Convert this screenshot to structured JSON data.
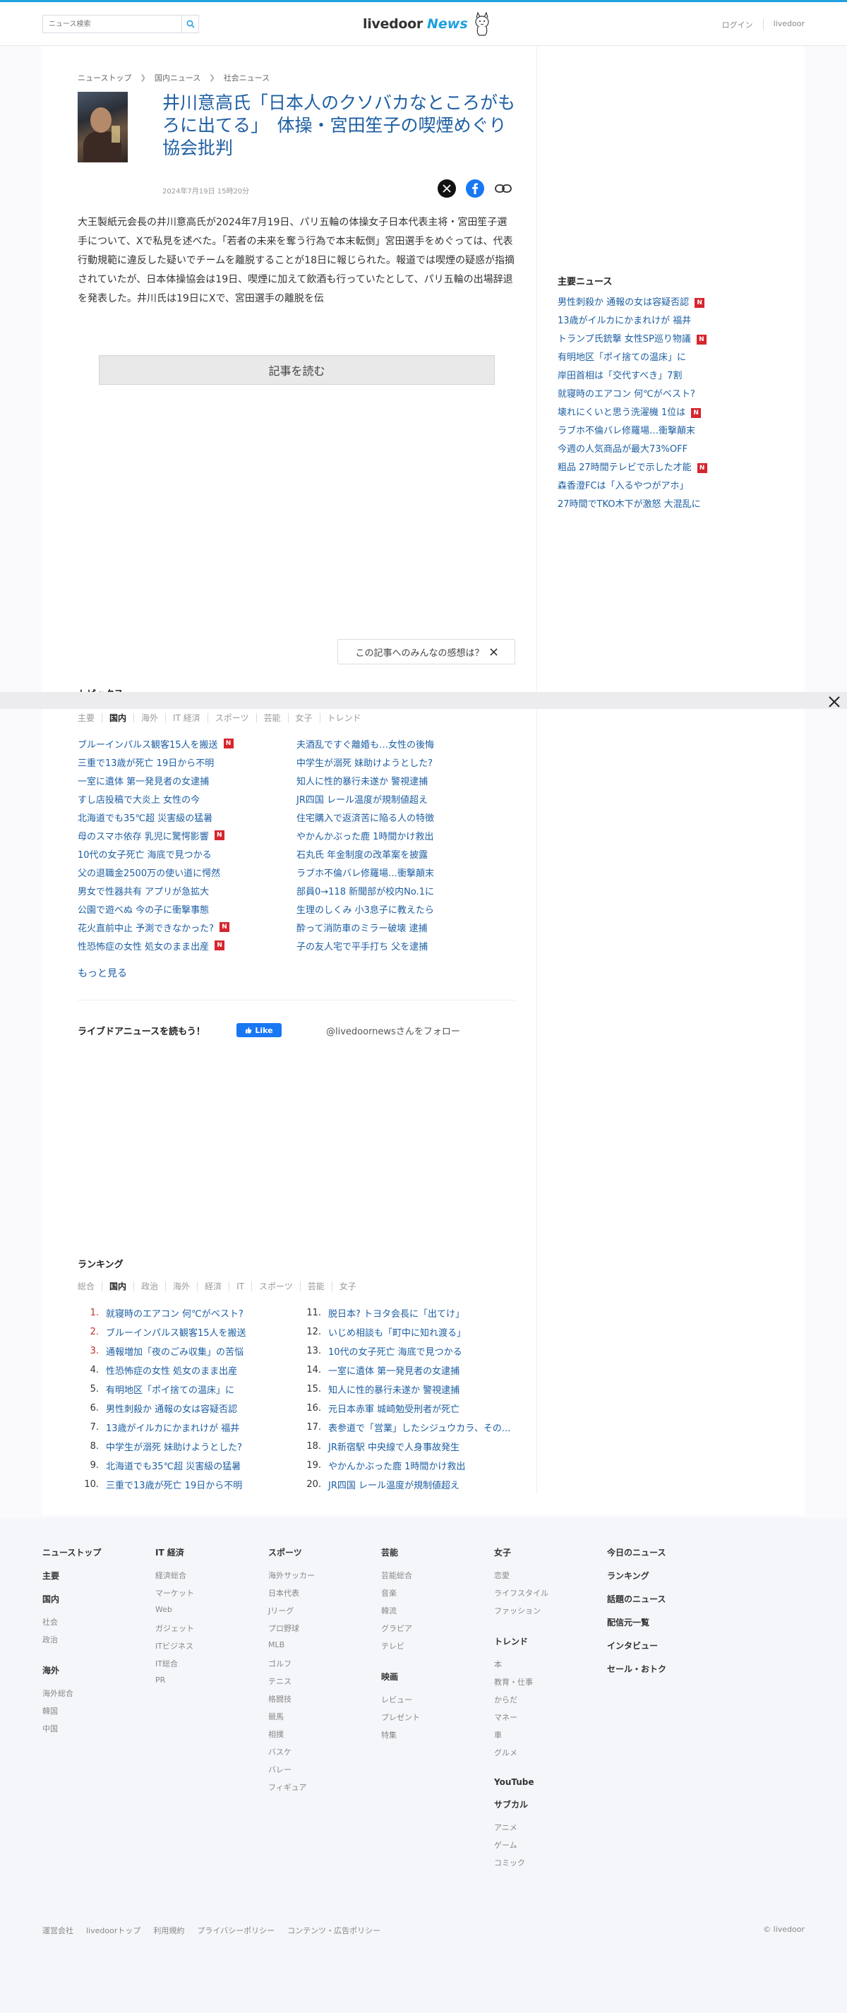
{
  "header": {
    "search_placeholder": "ニュース検索",
    "logo_word1": "livedoor",
    "logo_word2": "News",
    "links": [
      "ログイン",
      "livedoor"
    ]
  },
  "breadcrumb": [
    "ニューストップ",
    "国内ニュース",
    "社会ニュース"
  ],
  "article": {
    "title": "井川意高氏「日本人のクソバカなところがもろに出てる」　体操・宮田笙子の喫煙めぐり協会批判",
    "date": "2024年7月19日 15時20分",
    "body": "大王製紙元会長の井川意高氏が2024年7月19日、パリ五輪の体操女子日本代表主将・宮田笙子選手について、Xで私見を述べた。「若者の未来を奪う行為で本末転倒」宮田選手をめぐっては、代表行動規範に違反した疑いでチームを離脱することが18日に報じられた。報道では喫煙の疑惑が指摘されていたが、日本体操協会は19日、喫煙に加えて飲酒も行っていたとして、パリ五輪の出場辞退を発表した。井川氏は19日にXで、宮田選手の離脱を伝",
    "read_button": "記事を読む",
    "feel_button": "この記事へのみんなの感想は？"
  },
  "sidebar": {
    "title": "主要ニュース",
    "items": [
      {
        "text": "男性刺殺か 通報の女は容疑否認",
        "new": true
      },
      {
        "text": "13歳がイルカにかまれけが 福井",
        "new": false
      },
      {
        "text": "トランプ氏銃撃 女性SP巡り物議",
        "new": true
      },
      {
        "text": "有明地区「ポイ捨ての温床」に",
        "new": false
      },
      {
        "text": "岸田首相は「交代すべき」7割",
        "new": false
      },
      {
        "text": "就寝時のエアコン 何℃がベスト?",
        "new": false
      },
      {
        "text": "壊れにくいと思う洗濯機 1位は",
        "new": true
      },
      {
        "text": "ラブホ不倫バレ修羅場…衝撃顛末",
        "new": false
      },
      {
        "text": "今週の人気商品が最大73%OFF",
        "new": false
      },
      {
        "text": "粗品 27時間テレビで示した才能",
        "new": true
      },
      {
        "text": "森香澄FCは「入るやつがアホ」",
        "new": false
      },
      {
        "text": "27時間でTKO木下が激怒 大混乱に",
        "new": false
      }
    ]
  },
  "topics": {
    "title": "トピックス",
    "tabs": [
      "主要",
      "国内",
      "海外",
      "IT 経済",
      "スポーツ",
      "芸能",
      "女子",
      "トレンド"
    ],
    "active_tab": "国内",
    "items": [
      {
        "text": "ブルーインパルス観客15人を搬送",
        "new": true
      },
      {
        "text": "夫酒乱ですぐ離婚も…女性の後悔",
        "new": false
      },
      {
        "text": "三重で13歳が死亡 19日から不明",
        "new": false
      },
      {
        "text": "中学生が溺死 妹助けようとした?",
        "new": false
      },
      {
        "text": "一室に遺体 第一発見者の女逮捕",
        "new": false
      },
      {
        "text": "知人に性的暴行未遂か 警視逮捕",
        "new": false
      },
      {
        "text": "すし店投稿で大炎上 女性の今",
        "new": false
      },
      {
        "text": "JR四国 レール温度が規制値超え",
        "new": false
      },
      {
        "text": "北海道でも35℃超 災害級の猛暑",
        "new": false
      },
      {
        "text": "住宅購入で返済苦に陥る人の特徴",
        "new": false
      },
      {
        "text": "母のスマホ依存 乳児に驚愕影響",
        "new": true
      },
      {
        "text": "やかんかぶった鹿 1時間かけ救出",
        "new": false
      },
      {
        "text": "10代の女子死亡 海底で見つかる",
        "new": false
      },
      {
        "text": "石丸氏 年金制度の改革案を披露",
        "new": false
      },
      {
        "text": "父の退職金2500万の使い道に愕然",
        "new": false
      },
      {
        "text": "ラブホ不倫バレ修羅場…衝撃顛末",
        "new": false
      },
      {
        "text": "男女で性器共有 アプリが急拡大",
        "new": false
      },
      {
        "text": "部員0→118 新聞部が校内No.1に",
        "new": false
      },
      {
        "text": "公園で遊べぬ 今の子に衝撃事態",
        "new": false
      },
      {
        "text": "生理のしくみ 小3息子に教えたら",
        "new": false
      },
      {
        "text": "花火直前中止 予測できなかった?",
        "new": true
      },
      {
        "text": "酔って消防車のミラー破壊 逮捕",
        "new": false
      },
      {
        "text": "性恐怖症の女性 処女のまま出産",
        "new": true
      },
      {
        "text": "子の友人宅で平手打ち 父を逮捕",
        "new": false
      }
    ],
    "more": "もっと見る"
  },
  "follow": {
    "label": "ライブドアニュースを読もう！",
    "fb_like": "Like",
    "twitter": "@livedoornewsさんをフォロー"
  },
  "ranking": {
    "title": "ランキング",
    "tabs": [
      "総合",
      "国内",
      "政治",
      "海外",
      "経済",
      "IT",
      "スポーツ",
      "芸能",
      "女子"
    ],
    "active_tab": "国内",
    "items": [
      {
        "rank": "1.",
        "text": "就寝時のエアコン 何℃がベスト?"
      },
      {
        "rank": "11.",
        "text": "脱日本? トヨタ会長に「出てけ」"
      },
      {
        "rank": "2.",
        "text": "ブルーインパルス観客15人を搬送"
      },
      {
        "rank": "12.",
        "text": "いじめ相談も「町中に知れ渡る」"
      },
      {
        "rank": "3.",
        "text": "通報増加「夜のごみ収集」の苦悩"
      },
      {
        "rank": "13.",
        "text": "10代の女子死亡 海底で見つかる"
      },
      {
        "rank": "4.",
        "text": "性恐怖症の女性 処女のまま出産"
      },
      {
        "rank": "14.",
        "text": "一室に遺体 第一発見者の女逮捕"
      },
      {
        "rank": "5.",
        "text": "有明地区「ポイ捨ての温床」に"
      },
      {
        "rank": "15.",
        "text": "知人に性的暴行未遂か 警視逮捕"
      },
      {
        "rank": "6.",
        "text": "男性刺殺か 通報の女は容疑否認"
      },
      {
        "rank": "16.",
        "text": "元日本赤軍 城崎勉受刑者が死亡"
      },
      {
        "rank": "7.",
        "text": "13歳がイルカにかまれけが 福井"
      },
      {
        "rank": "17.",
        "text": "表参道で「営業」したシジュウカラ、その..."
      },
      {
        "rank": "8.",
        "text": "中学生が溺死 妹助けようとした?"
      },
      {
        "rank": "18.",
        "text": "JR新宿駅 中央線で人身事故発生"
      },
      {
        "rank": "9.",
        "text": "北海道でも35℃超 災害級の猛暑"
      },
      {
        "rank": "19.",
        "text": "やかんかぶった鹿 1時間かけ救出"
      },
      {
        "rank": "10.",
        "text": "三重で13歳が死亡 19日から不明"
      },
      {
        "rank": "20.",
        "text": "JR四国 レール温度が規制値超え"
      }
    ]
  },
  "footer": {
    "col1": {
      "groups": [
        {
          "head": "ニューストップ",
          "items": []
        },
        {
          "head": "主要",
          "items": []
        },
        {
          "head": "国内",
          "items": [
            "社会",
            "政治"
          ]
        },
        {
          "head": "海外",
          "items": [
            "海外総合",
            "韓国",
            "中国"
          ]
        }
      ]
    },
    "col2": {
      "groups": [
        {
          "head": "IT 経済",
          "items": [
            "経済総合",
            "マーケット",
            "Web",
            "ガジェット",
            "ITビジネス",
            "IT総合",
            "PR"
          ]
        }
      ]
    },
    "col3": {
      "groups": [
        {
          "head": "スポーツ",
          "items": [
            "海外サッカー",
            "日本代表",
            "Jリーグ",
            "プロ野球",
            "MLB",
            "ゴルフ",
            "テニス",
            "格闘技",
            "競馬",
            "相撲",
            "バスケ",
            "バレー",
            "フィギュア"
          ]
        }
      ]
    },
    "col4": {
      "groups": [
        {
          "head": "芸能",
          "items": [
            "芸能総合",
            "音楽",
            "韓流",
            "グラビア",
            "テレビ"
          ]
        },
        {
          "head": "映画",
          "items": [
            "レビュー",
            "プレゼント",
            "特集"
          ]
        }
      ]
    },
    "col5": {
      "groups": [
        {
          "head": "女子",
          "items": [
            "恋愛",
            "ライフスタイル",
            "ファッション"
          ]
        },
        {
          "head": "トレンド",
          "items": [
            "本",
            "教育・仕事",
            "からだ",
            "マネー",
            "車",
            "グルメ"
          ]
        },
        {
          "head": "YouTube",
          "items": []
        },
        {
          "head": "サブカル",
          "items": [
            "アニメ",
            "ゲーム",
            "コミック"
          ]
        }
      ]
    },
    "col6": {
      "groups": [
        {
          "head": "今日のニュース",
          "items": []
        },
        {
          "head": "ランキング",
          "items": []
        },
        {
          "head": "話題のニュース",
          "items": []
        },
        {
          "head": "配信元一覧",
          "items": []
        },
        {
          "head": "インタビュー",
          "items": []
        },
        {
          "head": "セール・おトク",
          "items": []
        }
      ]
    },
    "bottom_links": [
      "運営会社",
      "livedoorトップ",
      "利用規約",
      "プライバシーポリシー",
      "コンテンツ・広告ポリシー"
    ],
    "copyright": "© livedoor"
  },
  "colors": {
    "accent": "#1fa0dd",
    "link": "#1e5fa3",
    "new_badge": "#d6252d",
    "facebook": "#1877f2"
  }
}
